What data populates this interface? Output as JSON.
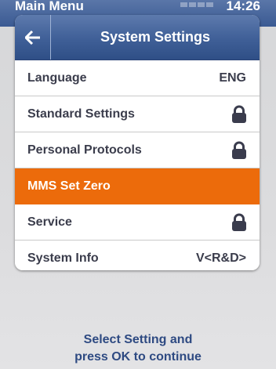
{
  "statusbar": {
    "title": "Main Menu",
    "time": "14:26"
  },
  "header": {
    "back_icon": "arrow-left-icon",
    "title": "System Settings"
  },
  "menu": {
    "items": [
      {
        "label": "Language",
        "value": "ENG",
        "locked": false,
        "selected": false
      },
      {
        "label": "Standard Settings",
        "value": "",
        "locked": true,
        "selected": false
      },
      {
        "label": "Personal Protocols",
        "value": "",
        "locked": true,
        "selected": false
      },
      {
        "label": "MMS Set Zero",
        "value": "",
        "locked": false,
        "selected": true
      },
      {
        "label": "Service",
        "value": "",
        "locked": true,
        "selected": false
      },
      {
        "label": "System Info",
        "value": "V<R&D>",
        "locked": false,
        "selected": false
      }
    ],
    "lock_icon": "lock-icon"
  },
  "hint": {
    "line1": "Select Setting and",
    "line2": "press OK to continue"
  },
  "colors": {
    "header": "#3f5f97",
    "selected": "#ec6b0b",
    "text": "#3b3d4c",
    "hint": "#2e4a82"
  }
}
